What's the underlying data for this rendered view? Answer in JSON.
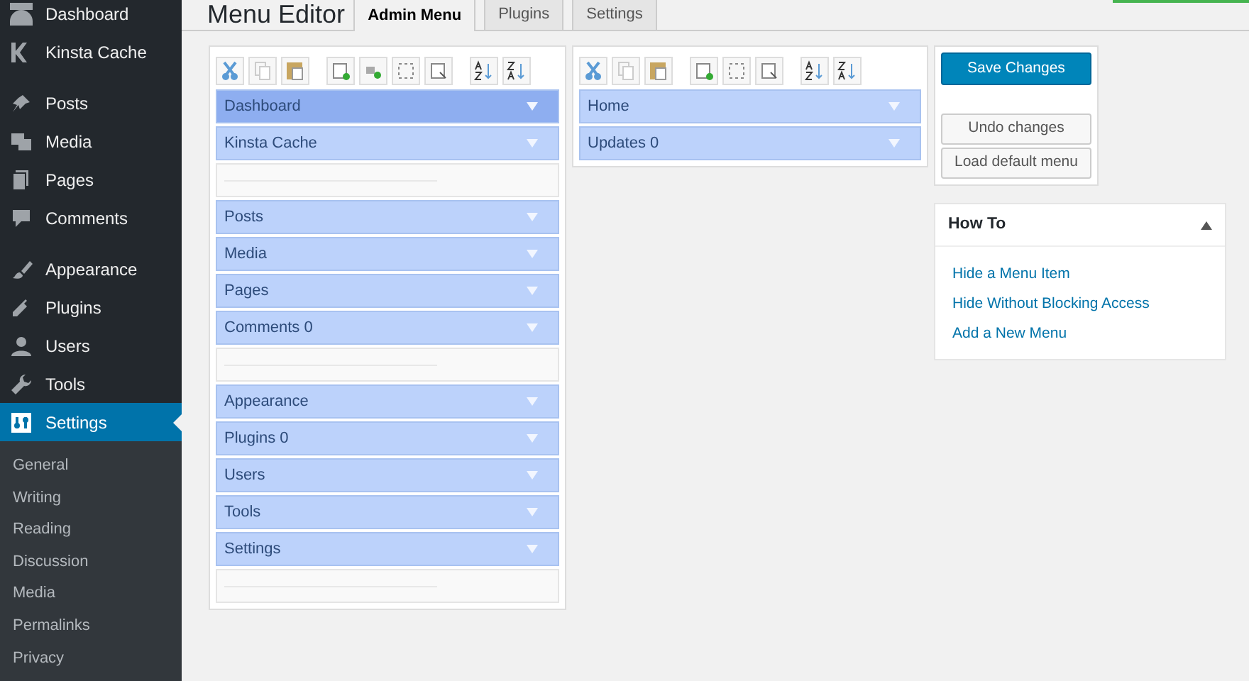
{
  "sidebar": {
    "items": [
      {
        "label": "Dashboard",
        "selected": false,
        "gap_before": false
      },
      {
        "label": "Kinsta Cache",
        "selected": false,
        "gap_before": false
      },
      {
        "label": "Posts",
        "selected": false,
        "gap_before": true
      },
      {
        "label": "Media",
        "selected": false,
        "gap_before": false
      },
      {
        "label": "Pages",
        "selected": false,
        "gap_before": false
      },
      {
        "label": "Comments",
        "selected": false,
        "gap_before": false
      },
      {
        "label": "Appearance",
        "selected": false,
        "gap_before": true
      },
      {
        "label": "Plugins",
        "selected": false,
        "gap_before": false
      },
      {
        "label": "Users",
        "selected": false,
        "gap_before": false
      },
      {
        "label": "Tools",
        "selected": false,
        "gap_before": false
      },
      {
        "label": "Settings",
        "selected": true,
        "gap_before": false
      }
    ],
    "submenu": [
      "General",
      "Writing",
      "Reading",
      "Discussion",
      "Media",
      "Permalinks",
      "Privacy"
    ]
  },
  "page_title": "Menu Editor",
  "tabs": [
    {
      "label": "Admin Menu",
      "selected": true
    },
    {
      "label": "Plugins",
      "selected": false
    },
    {
      "label": "Settings",
      "selected": false
    }
  ],
  "top_menu": {
    "items": [
      {
        "kind": "item",
        "label": "Dashboard",
        "selected": true
      },
      {
        "kind": "item",
        "label": "Kinsta Cache",
        "selected": false
      },
      {
        "kind": "separator"
      },
      {
        "kind": "item",
        "label": "Posts",
        "selected": false
      },
      {
        "kind": "item",
        "label": "Media",
        "selected": false
      },
      {
        "kind": "item",
        "label": "Pages",
        "selected": false
      },
      {
        "kind": "item",
        "label": "Comments 0",
        "selected": false
      },
      {
        "kind": "separator"
      },
      {
        "kind": "item",
        "label": "Appearance",
        "selected": false
      },
      {
        "kind": "item",
        "label": "Plugins 0",
        "selected": false
      },
      {
        "kind": "item",
        "label": "Users",
        "selected": false
      },
      {
        "kind": "item",
        "label": "Tools",
        "selected": false
      },
      {
        "kind": "item",
        "label": "Settings",
        "selected": false
      },
      {
        "kind": "separator"
      }
    ]
  },
  "submenu_panel": {
    "items": [
      {
        "kind": "item",
        "label": "Home",
        "selected": false
      },
      {
        "kind": "item",
        "label": "Updates 0",
        "selected": false
      }
    ]
  },
  "buttons": {
    "save": "Save Changes",
    "undo": "Undo changes",
    "load_default": "Load default menu"
  },
  "how_to": {
    "title": "How To",
    "expanded": true,
    "links": [
      "Hide a Menu Item",
      "Hide Without Blocking Access",
      "Add a New Menu"
    ]
  }
}
